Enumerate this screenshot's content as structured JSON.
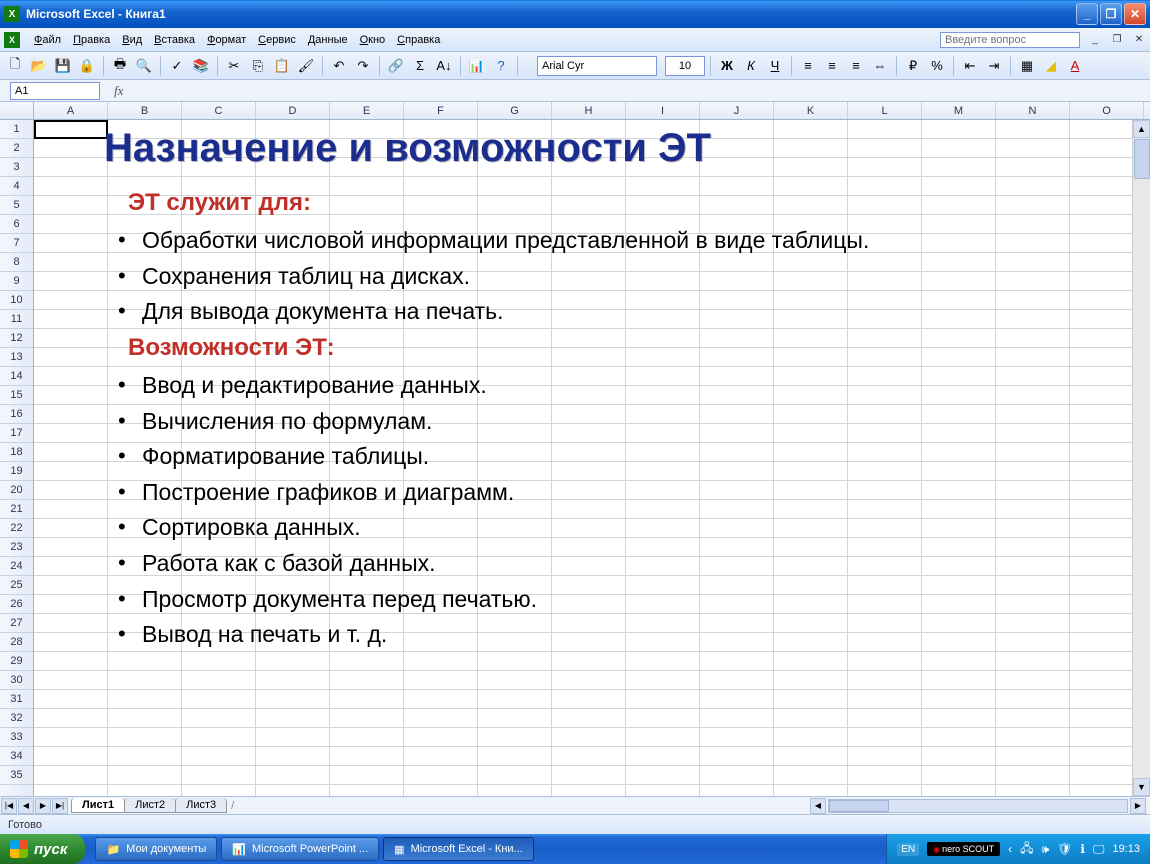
{
  "titlebar": {
    "text": "Microsoft Excel - Книга1"
  },
  "menubar": {
    "items": [
      "Файл",
      "Правка",
      "Вид",
      "Вставка",
      "Формат",
      "Сервис",
      "Данные",
      "Окно",
      "Справка"
    ],
    "question_placeholder": "Введите вопрос"
  },
  "formatting": {
    "font_name": "Arial Cyr",
    "font_size": "10"
  },
  "namebox": {
    "ref": "A1"
  },
  "columns": [
    "A",
    "B",
    "C",
    "D",
    "E",
    "F",
    "G",
    "H",
    "I",
    "J",
    "K",
    "L",
    "M",
    "N",
    "O"
  ],
  "row_count": 35,
  "sheet_tabs": [
    "Лист1",
    "Лист2",
    "Лист3"
  ],
  "statusbar": {
    "text": "Готово"
  },
  "slide": {
    "title": "Назначение и возможности ЭТ",
    "section1": "ЭТ служит для:",
    "bullets1": [
      "Обработки числовой информации представленной в виде таблицы.",
      "Сохранения таблиц на дисках.",
      "Для вывода документа на печать."
    ],
    "section2": "Возможности ЭТ:",
    "bullets2": [
      "Ввод и редактирование данных.",
      "Вычисления по формулам.",
      "Форматирование таблицы.",
      "Построение графиков и диаграмм.",
      "Сортировка данных.",
      "Работа как с базой данных.",
      "Просмотр документа перед печатью.",
      "Вывод на печать и т. д."
    ]
  },
  "taskbar": {
    "start": "пуск",
    "items": [
      {
        "icon": "📁",
        "label": "Мои документы"
      },
      {
        "icon": "📊",
        "label": "Microsoft PowerPoint ..."
      },
      {
        "icon": "▦",
        "label": "Microsoft Excel - Кни..."
      }
    ],
    "lang": "EN",
    "nero": "nero SCOUT",
    "clock": "19:13"
  }
}
